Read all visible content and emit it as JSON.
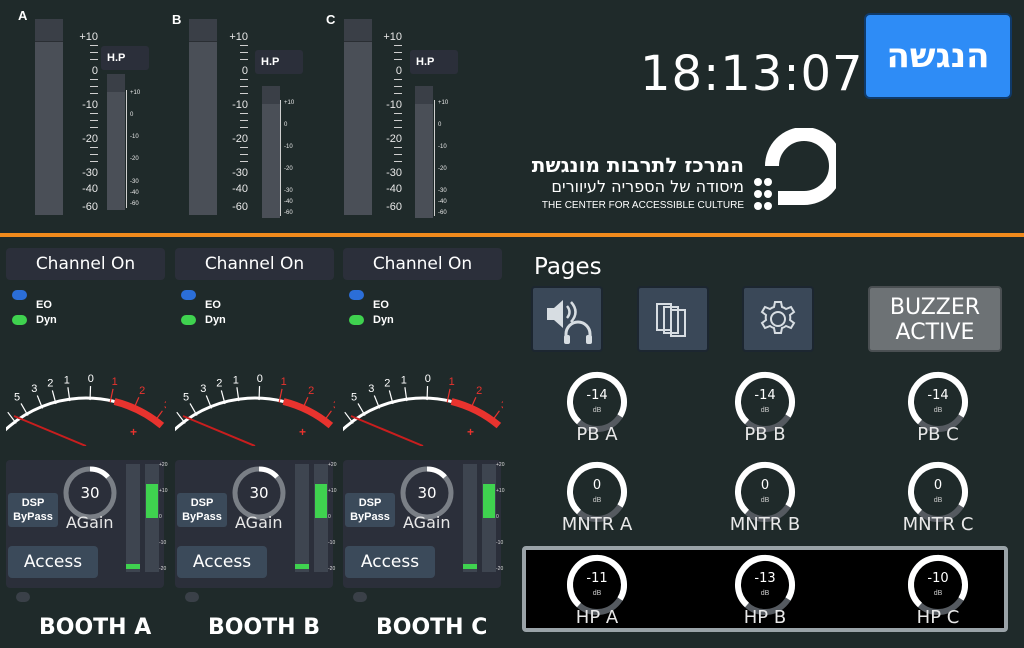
{
  "top_meters": {
    "channels": [
      {
        "letter": "A",
        "hp_label": "H.P"
      },
      {
        "letter": "B",
        "hp_label": "H.P"
      },
      {
        "letter": "C",
        "hp_label": "H.P"
      }
    ],
    "big_scale": [
      "+10",
      "0",
      "-10",
      "-20",
      "-30",
      "-40",
      "-60"
    ],
    "small_scale": [
      "+10",
      "0",
      "-10",
      "-20",
      "-30",
      "-40",
      "-60"
    ]
  },
  "clock": "18:13:07",
  "present_button": "הנגשה",
  "logo": {
    "line1": "המרכז לתרבות מונגשת",
    "line2": "מיסודה של הספריה לעיוורים",
    "line3": "THE CENTER FOR ACCESSIBLE CULTURE"
  },
  "strips": [
    {
      "channel_on": "Channel On",
      "eo": "EO",
      "dyn": "Dyn",
      "knob": "30",
      "again": "AGain",
      "dsp1": "DSP",
      "dsp2": "ByPass",
      "access": "Access",
      "booth": "BOOTH A"
    },
    {
      "channel_on": "Channel On",
      "eo": "EO",
      "dyn": "Dyn",
      "knob": "30",
      "again": "AGain",
      "dsp1": "DSP",
      "dsp2": "ByPass",
      "access": "Access",
      "booth": "BOOTH B"
    },
    {
      "channel_on": "Channel On",
      "eo": "EO",
      "dyn": "Dyn",
      "knob": "30",
      "again": "AGain",
      "dsp1": "DSP",
      "dsp2": "ByPass",
      "access": "Access",
      "booth": "BOOTH C"
    }
  ],
  "vu_scale": [
    "20",
    "10",
    "7",
    "5",
    "3",
    "2",
    "1",
    "0",
    "1",
    "2",
    "3",
    "+"
  ],
  "strip_meter_scale": [
    "+20",
    "+10",
    "0",
    "-10",
    "-20"
  ],
  "colors": {
    "led_eo": "#2b6ed8",
    "led_dyn": "#3fd24f",
    "accent_orange": "#f08a1c",
    "blue_button": "#2e8cf6",
    "meter_green": "#3fd24f",
    "vu_red": "#e8332e"
  },
  "pages": {
    "title": "Pages",
    "icons": [
      "speaker-headphones-icon",
      "pages-icon",
      "gear-icon"
    ],
    "buzzer_line1": "BUZZER",
    "buzzer_line2": "ACTIVE"
  },
  "knobs": [
    {
      "value": "-14",
      "unit": "dB",
      "label": "PB A"
    },
    {
      "value": "-14",
      "unit": "dB",
      "label": "PB B"
    },
    {
      "value": "-14",
      "unit": "dB",
      "label": "PB C"
    },
    {
      "value": "0",
      "unit": "dB",
      "label": "MNTR A"
    },
    {
      "value": "0",
      "unit": "dB",
      "label": "MNTR B"
    },
    {
      "value": "0",
      "unit": "dB",
      "label": "MNTR C"
    },
    {
      "value": "-11",
      "unit": "dB",
      "label": "HP A"
    },
    {
      "value": "-13",
      "unit": "dB",
      "label": "HP B"
    },
    {
      "value": "-10",
      "unit": "dB",
      "label": "HP C"
    }
  ]
}
